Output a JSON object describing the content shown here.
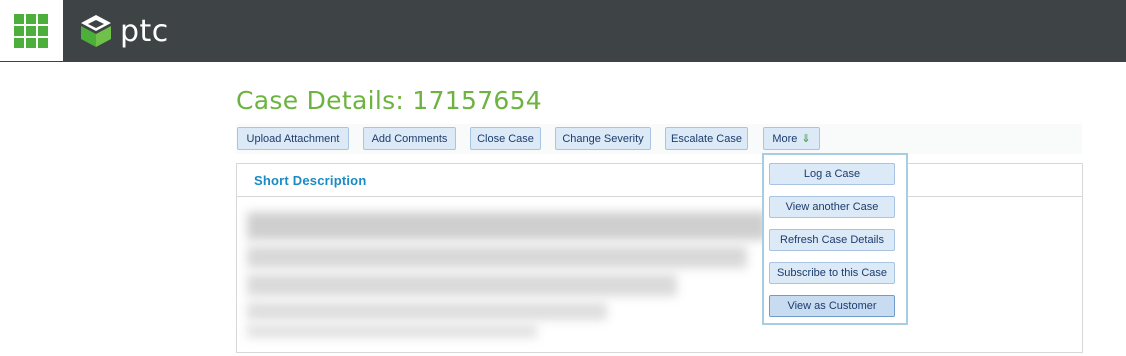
{
  "header": {
    "brand": "ptc"
  },
  "page": {
    "title": "Case Details: 17157654"
  },
  "toolbar": {
    "buttons": [
      "Upload Attachment",
      "Add Comments",
      "Close Case",
      "Change Severity",
      "Escalate Case"
    ],
    "more_label": "More",
    "more_arrow": "⇓"
  },
  "panel": {
    "title": "Short Description"
  },
  "more_menu": {
    "items": [
      "Log a Case",
      "View another Case",
      "Refresh Case Details",
      "Subscribe to this Case",
      "View as Customer"
    ]
  },
  "colors": {
    "header_bg": "#3e4345",
    "brand_green": "#4caf3a",
    "title_green": "#6db33f",
    "link_blue": "#1a8bc4",
    "button_bg": "#dce9f6"
  },
  "icons": {
    "apps": "apps-grid-icon",
    "logo": "ptc-logo-icon"
  }
}
